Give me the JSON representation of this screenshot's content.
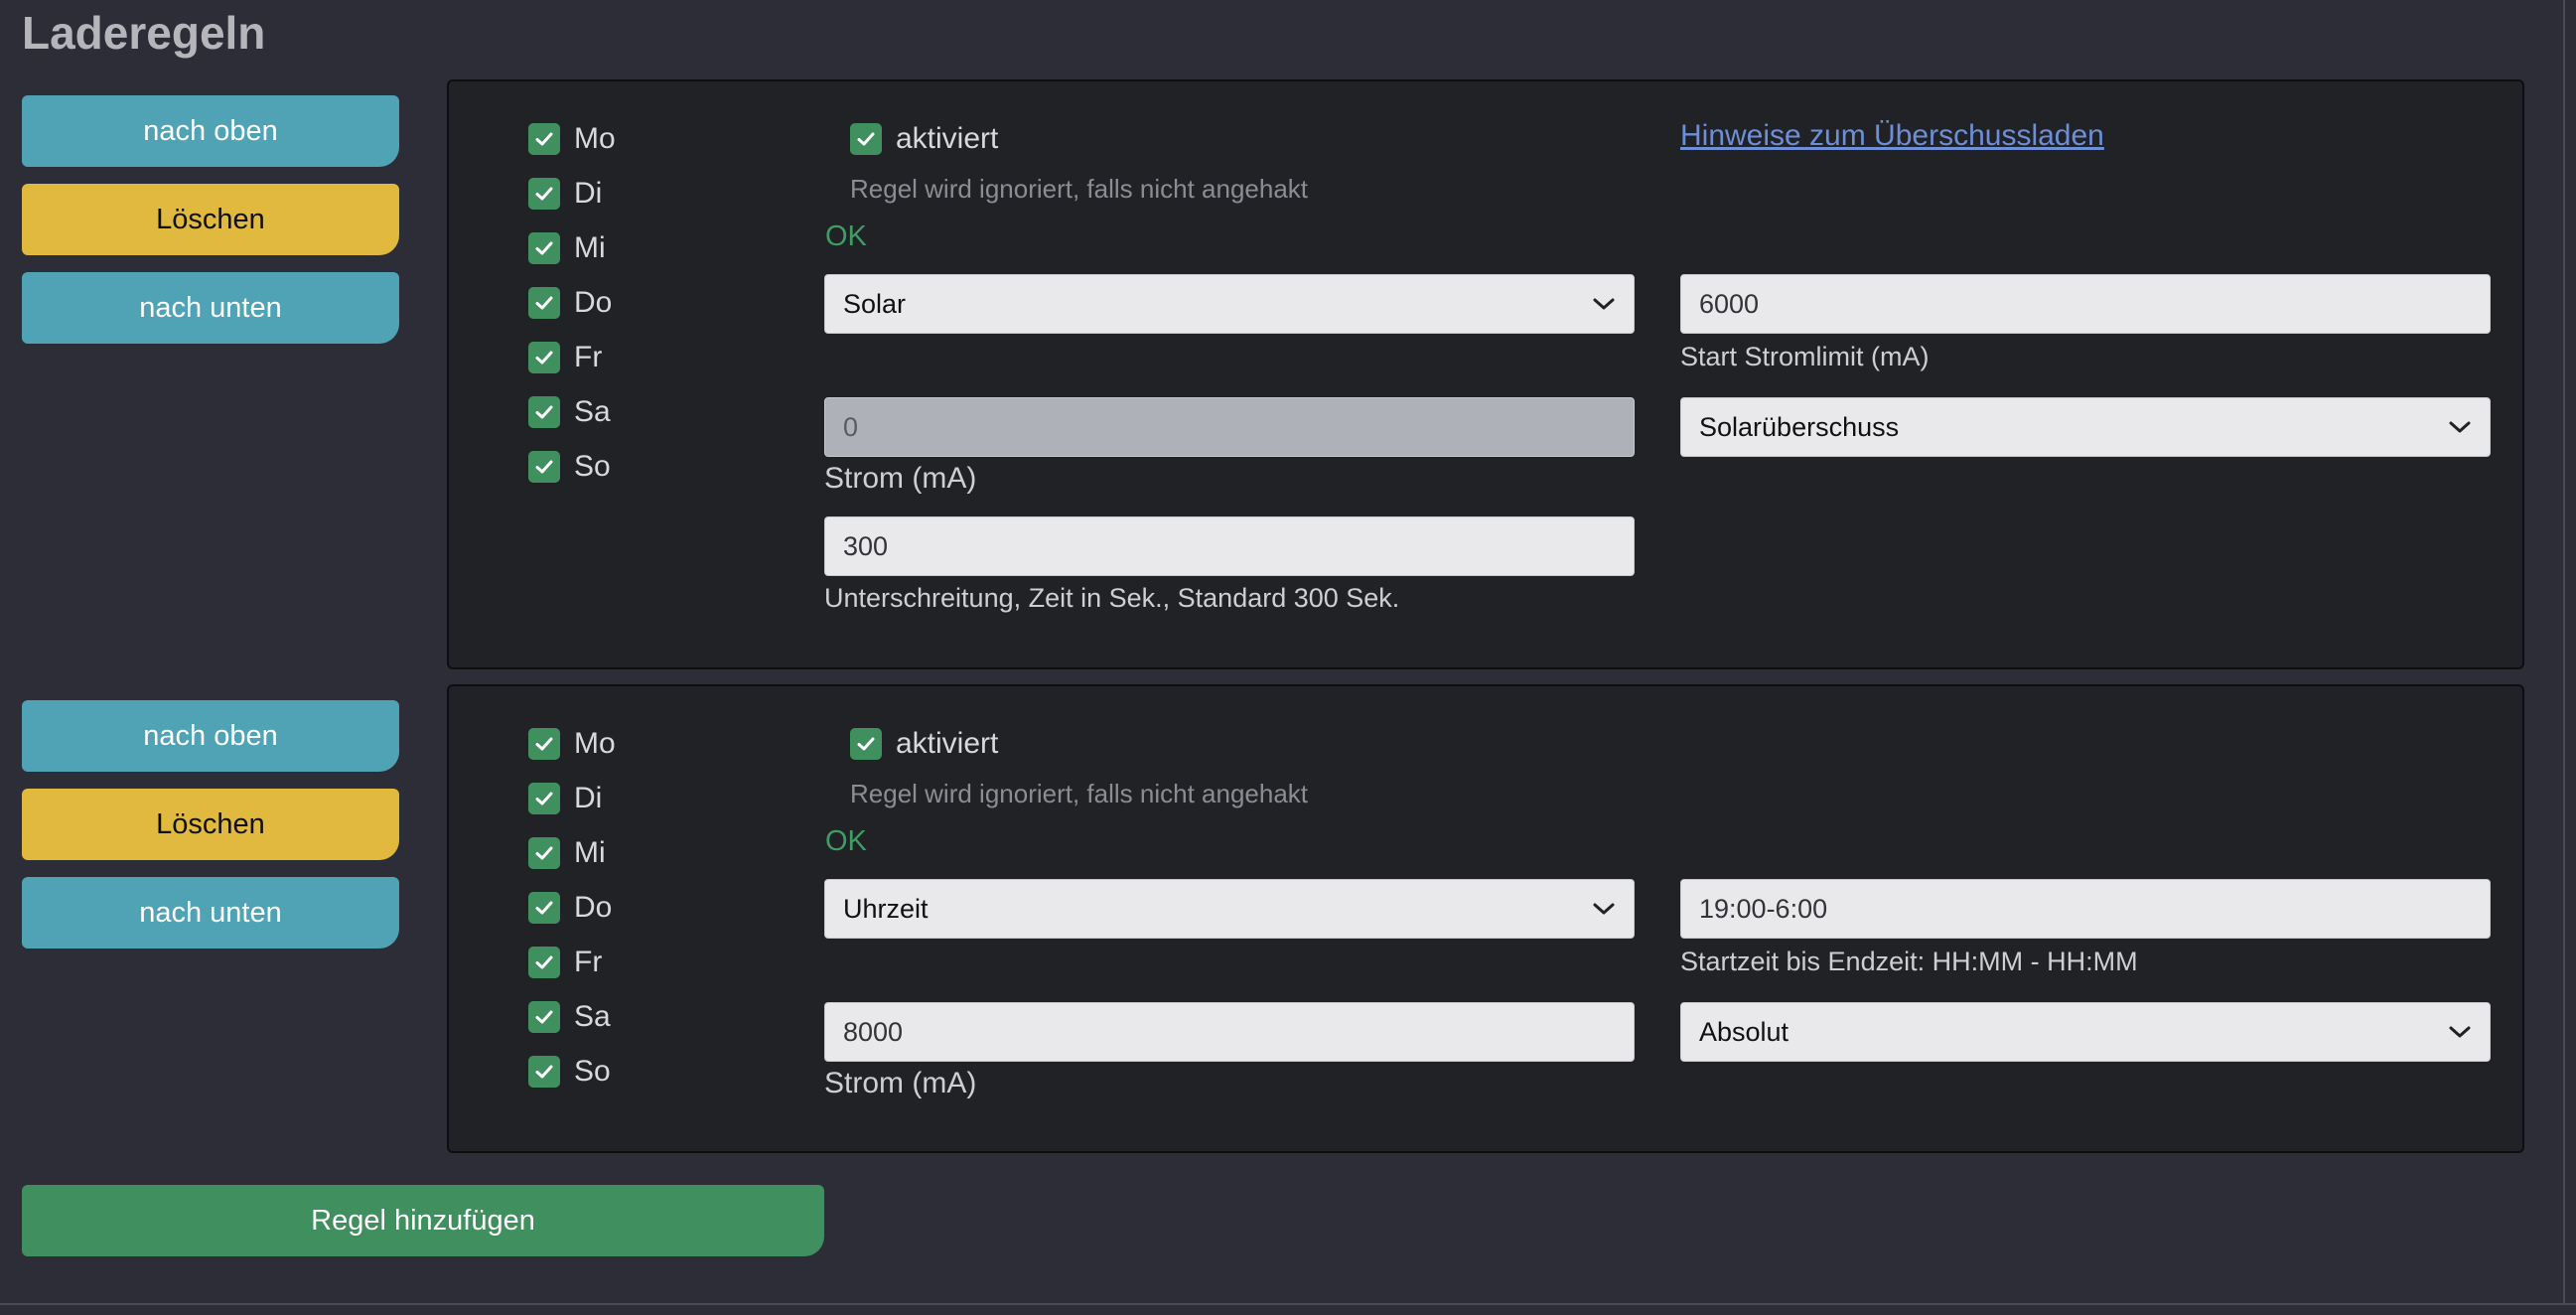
{
  "page": {
    "title": "Laderegeln"
  },
  "buttons": {
    "up": "nach oben",
    "delete": "Löschen",
    "down": "nach unten",
    "add_rule": "Regel hinzufügen"
  },
  "colors": {
    "accent_teal": "#4fa3b5",
    "warning_yellow": "#e1b93e",
    "success_green": "#3f8f5f",
    "link_blue": "#6e8fd6"
  },
  "rules": [
    {
      "days": [
        {
          "label": "Mo",
          "checked": true
        },
        {
          "label": "Di",
          "checked": true
        },
        {
          "label": "Mi",
          "checked": true
        },
        {
          "label": "Do",
          "checked": true
        },
        {
          "label": "Fr",
          "checked": true
        },
        {
          "label": "Sa",
          "checked": true
        },
        {
          "label": "So",
          "checked": true
        }
      ],
      "enabled_label": "aktiviert",
      "enabled_hint": "Regel wird ignoriert, falls nicht angehakt",
      "status": "OK",
      "link": "Hinweise zum Überschussladen",
      "mode_select": "Solar",
      "start_current_value": "6000",
      "start_current_label": "Start Stromlimit (mA)",
      "current_value": "0",
      "current_label": "Strom (mA)",
      "type_select": "Solarüberschuss",
      "undershoot_value": "300",
      "undershoot_label": "Unterschreitung, Zeit in Sek., Standard 300 Sek."
    },
    {
      "days": [
        {
          "label": "Mo",
          "checked": true
        },
        {
          "label": "Di",
          "checked": true
        },
        {
          "label": "Mi",
          "checked": true
        },
        {
          "label": "Do",
          "checked": true
        },
        {
          "label": "Fr",
          "checked": true
        },
        {
          "label": "Sa",
          "checked": true
        },
        {
          "label": "So",
          "checked": true
        }
      ],
      "enabled_label": "aktiviert",
      "enabled_hint": "Regel wird ignoriert, falls nicht angehakt",
      "status": "OK",
      "mode_select": "Uhrzeit",
      "time_value": "19:00-6:00",
      "time_label": "Startzeit bis Endzeit: HH:MM - HH:MM",
      "current_value": "8000",
      "current_label": "Strom (mA)",
      "type_select": "Absolut"
    }
  ]
}
